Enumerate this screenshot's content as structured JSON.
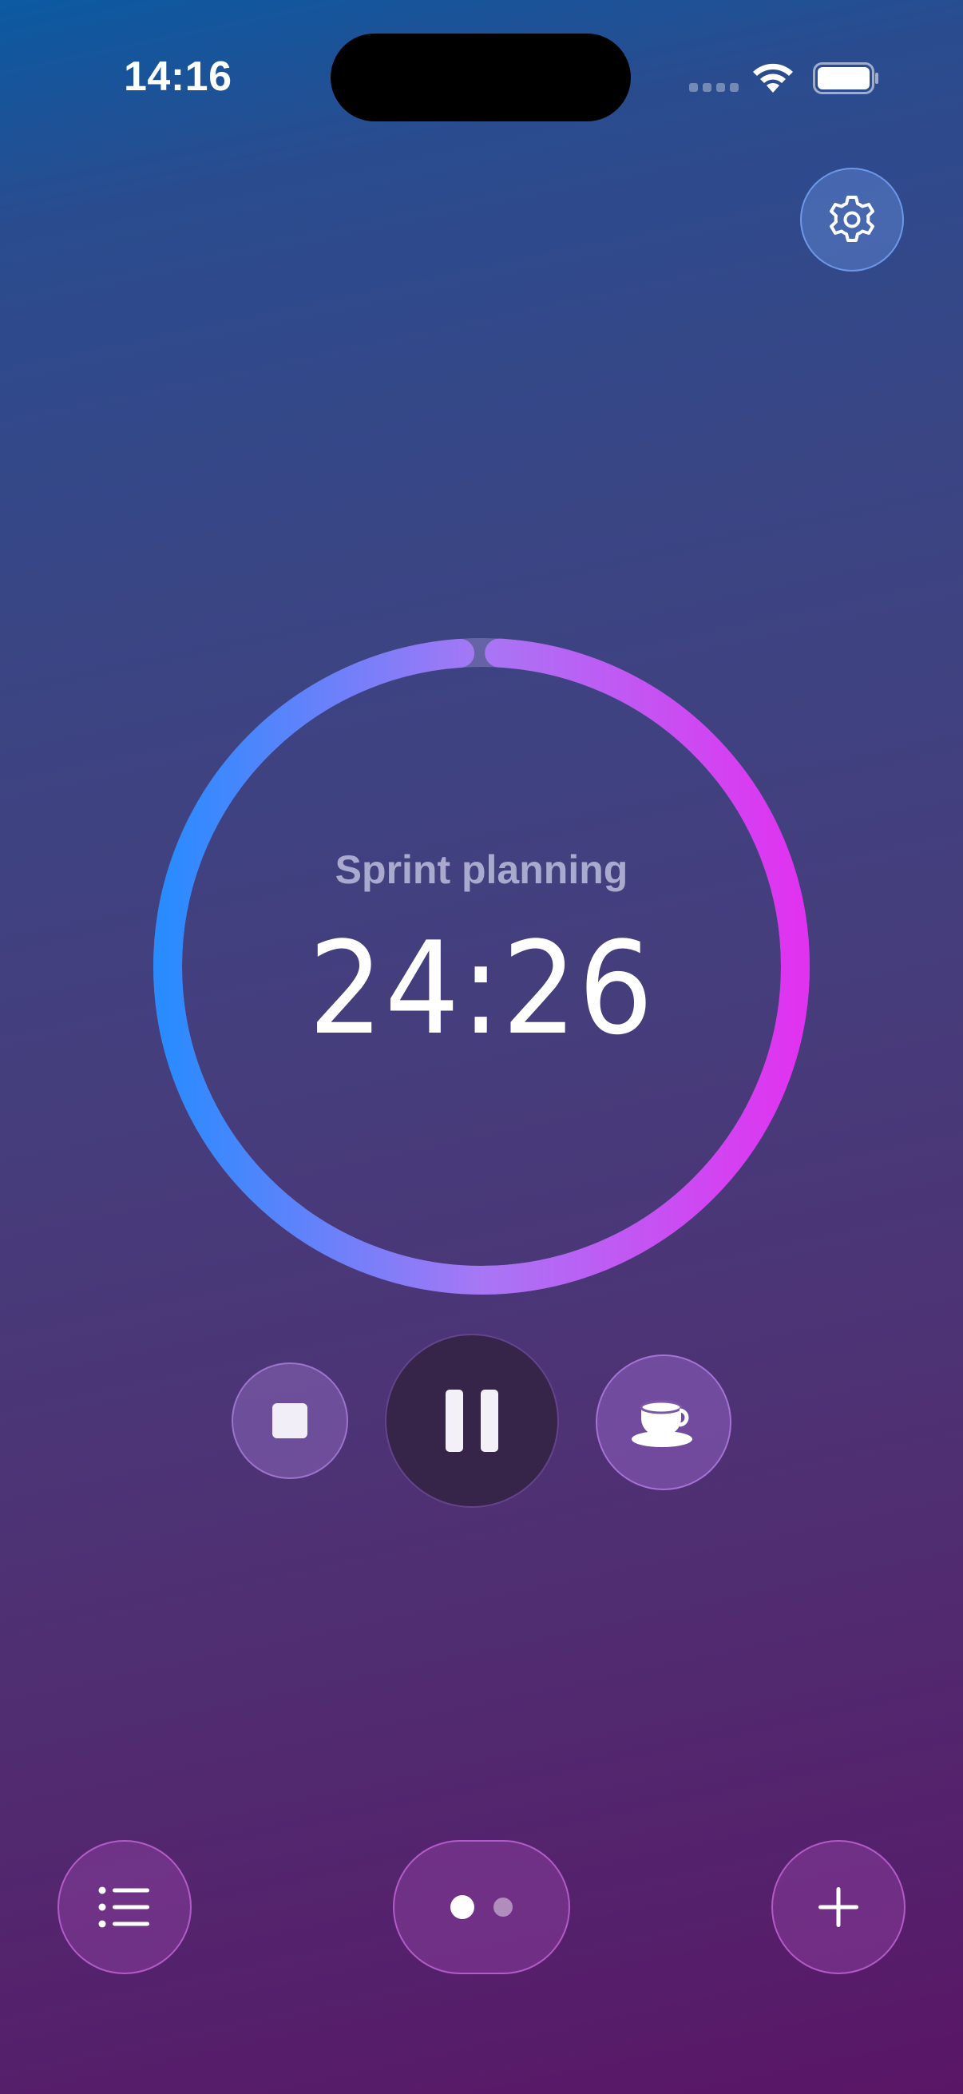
{
  "status_bar": {
    "time": "14:16"
  },
  "timer": {
    "task_name": "Sprint planning",
    "remaining": "24:26",
    "progress_fraction": 0.98
  },
  "controls": {
    "stop_icon": "stop-icon",
    "pause_icon": "pause-icon",
    "break_icon": "coffee-cup-icon"
  },
  "bottom_bar": {
    "list_icon": "list-icon",
    "add_icon": "plus-icon",
    "page_count": 2,
    "current_page": 1
  },
  "colors": {
    "ring_top": "#2a8bff",
    "ring_middle": "#a777f5",
    "ring_bottom": "#e033f0",
    "background_top": "#0b5aa2",
    "background_bottom": "#5a1666"
  }
}
